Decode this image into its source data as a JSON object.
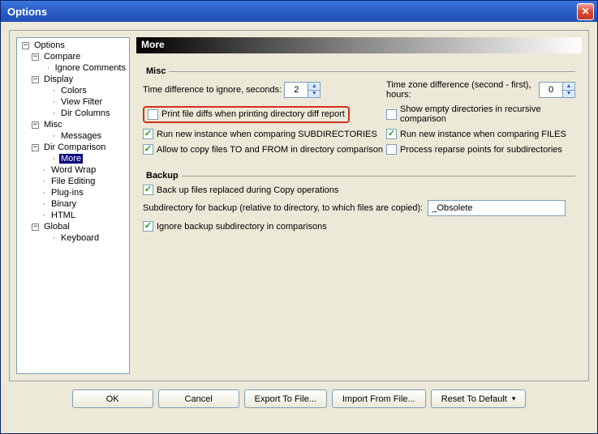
{
  "window": {
    "title": "Options"
  },
  "tree": {
    "root": "Options",
    "compare": "Compare",
    "ignoreComments": "Ignore Comments",
    "display": "Display",
    "colors": "Colors",
    "viewFilter": "View Filter",
    "dirColumns": "Dir Columns",
    "misc": "Misc",
    "messages": "Messages",
    "dirComparison": "Dir Comparison",
    "more": "More",
    "wordWrap": "Word Wrap",
    "fileEditing": "File Editing",
    "plugins": "Plug-ins",
    "binary": "Binary",
    "html": "HTML",
    "global": "Global",
    "keyboard": "Keyboard"
  },
  "header": {
    "title": "More"
  },
  "misc": {
    "groupLabel": "Misc",
    "timeDiffLabel": "Time difference to ignore, seconds:",
    "timeDiffValue": "2",
    "tzLabel": "Time zone difference (second - first), hours:",
    "tzValue": "0",
    "printDiffs": "Print file diffs when printing directory diff report",
    "showEmpty": "Show empty directories in recursive comparison",
    "runNewSub": "Run new instance when comparing SUBDIRECTORIES",
    "runNewFiles": "Run new instance when comparing FILES",
    "allowCopy": "Allow to copy files TO and FROM in directory comparison",
    "reparse": "Process reparse points for subdirectories"
  },
  "backup": {
    "groupLabel": "Backup",
    "backupReplaced": "Back up files replaced during Copy operations",
    "subdirLabel": "Subdirectory for backup (relative to directory, to which files are copied):",
    "subdirValue": "_Obsolete",
    "ignoreBackup": "Ignore backup subdirectory in comparisons"
  },
  "buttons": {
    "ok": "OK",
    "cancel": "Cancel",
    "export": "Export To File...",
    "import": "Import From File...",
    "reset": "Reset To Default"
  }
}
